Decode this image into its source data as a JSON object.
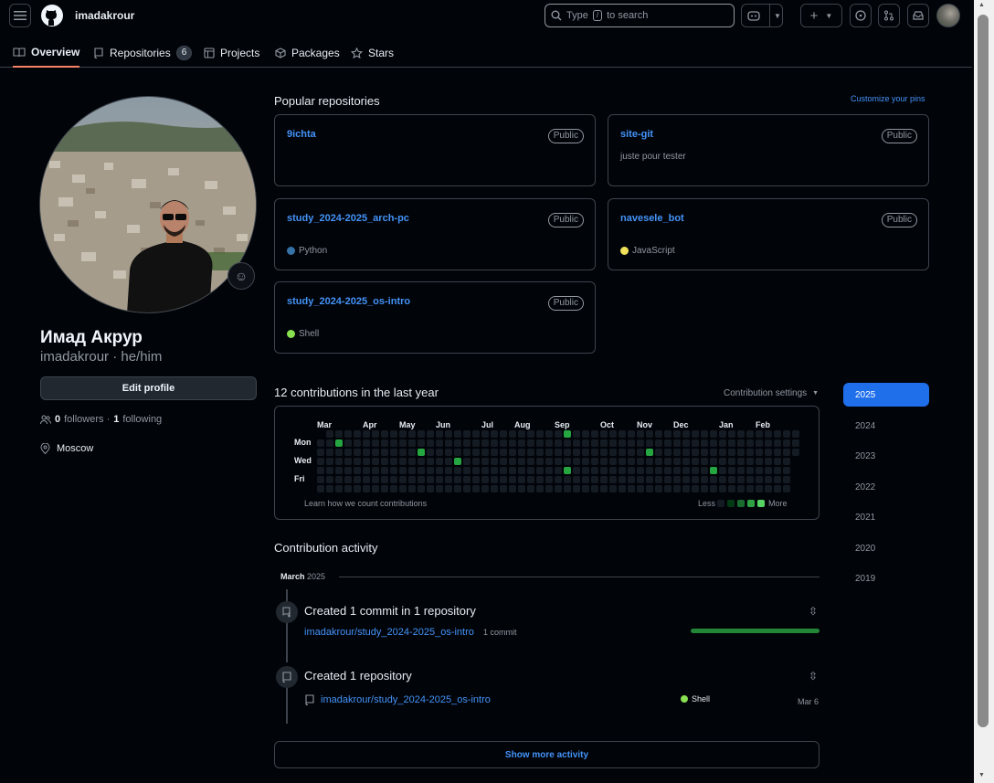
{
  "header": {
    "username": "imadakrour",
    "search_prefix": "Type",
    "search_key": "/",
    "search_suffix": "to search"
  },
  "tabs": [
    {
      "label": "Overview",
      "icon": "book-icon"
    },
    {
      "label": "Repositories",
      "icon": "repo-icon",
      "count": "6"
    },
    {
      "label": "Projects",
      "icon": "table-icon"
    },
    {
      "label": "Packages",
      "icon": "package-icon"
    },
    {
      "label": "Stars",
      "icon": "star-icon"
    }
  ],
  "profile": {
    "name": "Имад Акрур",
    "handle": "imadakrour · he/him",
    "edit_label": "Edit profile",
    "followers_count": "0",
    "followers_label": "followers ·",
    "following_count": "1",
    "following_label": "following",
    "location": "Moscow"
  },
  "popular": {
    "title": "Popular repositories",
    "customize": "Customize your pins",
    "repos": [
      {
        "name": "9ichta",
        "visibility": "Public",
        "description": "",
        "language": "",
        "color": ""
      },
      {
        "name": "site-git",
        "visibility": "Public",
        "description": "juste pour tester",
        "language": "",
        "color": ""
      },
      {
        "name": "study_2024-2025_arch-pc",
        "visibility": "Public",
        "description": "",
        "language": "Python",
        "color": "#3572A5"
      },
      {
        "name": "navesele_bot",
        "visibility": "Public",
        "description": "",
        "language": "JavaScript",
        "color": "#f1e05a"
      },
      {
        "name": "study_2024-2025_os-intro",
        "visibility": "Public",
        "description": "",
        "language": "Shell",
        "color": "#89e051"
      }
    ]
  },
  "contributions": {
    "title": "12 contributions in the last year",
    "settings": "Contribution settings",
    "months": [
      "Mar",
      "Apr",
      "May",
      "Jun",
      "Jul",
      "Aug",
      "Sep",
      "Oct",
      "Nov",
      "Dec",
      "Jan",
      "Feb"
    ],
    "days": [
      "Mon",
      "Wed",
      "Fri"
    ],
    "learn": "Learn how we count contributions",
    "less": "Less",
    "more": "More",
    "active_cells": [
      [
        2,
        1
      ],
      [
        11,
        2
      ],
      [
        15,
        3
      ],
      [
        27,
        0
      ],
      [
        27,
        4
      ],
      [
        36,
        2
      ],
      [
        43,
        4
      ]
    ]
  },
  "years": [
    "2025",
    "2024",
    "2023",
    "2022",
    "2021",
    "2020",
    "2019"
  ],
  "activity": {
    "title": "Contribution activity",
    "month": "March",
    "year": "2025",
    "items": [
      {
        "title": "Created 1 commit in 1 repository",
        "repo": "imadakrour/study_2024-2025_os-intro",
        "detail": "1 commit"
      },
      {
        "title": "Created 1 repository",
        "repo": "imadakrour/study_2024-2025_os-intro",
        "language": "Shell",
        "date": "Mar 6"
      }
    ],
    "show_more": "Show more activity"
  }
}
